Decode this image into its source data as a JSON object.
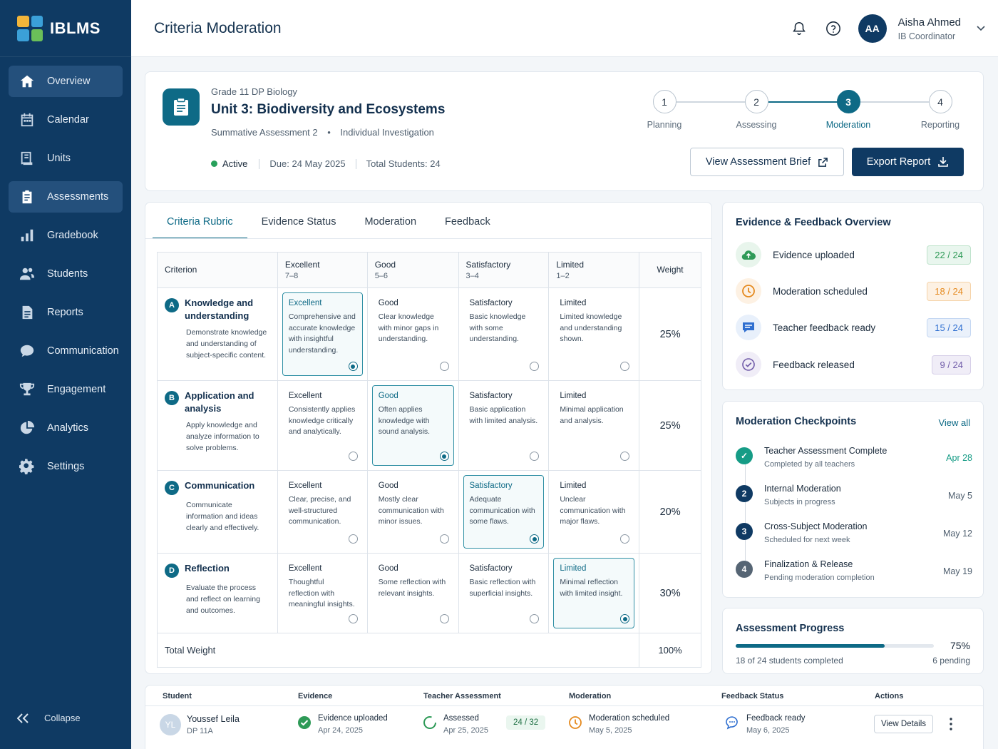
{
  "brand": {
    "name": "IBLMS"
  },
  "sidebar": {
    "items": [
      {
        "label": "Overview",
        "icon": "home-icon",
        "active": true
      },
      {
        "label": "Calendar",
        "icon": "calendar-icon",
        "active": false
      },
      {
        "label": "Units",
        "icon": "book-icon",
        "active": false
      },
      {
        "label": "Assessments",
        "icon": "clipboard-icon",
        "active": true
      },
      {
        "label": "Gradebook",
        "icon": "bar-chart-icon",
        "active": false
      },
      {
        "label": "Students",
        "icon": "users-icon",
        "active": false
      },
      {
        "label": "Reports",
        "icon": "document-icon",
        "active": false
      },
      {
        "label": "Communication",
        "icon": "chat-icon",
        "active": false
      },
      {
        "label": "Engagement",
        "icon": "trophy-icon",
        "active": false
      },
      {
        "label": "Analytics",
        "icon": "pie-chart-icon",
        "active": false
      },
      {
        "label": "Settings",
        "icon": "gear-icon",
        "active": false
      }
    ],
    "collapse_label": "Collapse"
  },
  "topbar": {
    "title": "Criteria Moderation",
    "user": {
      "initials": "AA",
      "name": "Aisha Ahmed",
      "role": "IB Coordinator"
    }
  },
  "assessment": {
    "grade": "Grade 11 DP Biology",
    "unit_title": "Unit 3: Biodiversity and Ecosystems",
    "type": "Summative Assessment 2",
    "task": "Individual Investigation",
    "status": "Active",
    "due": "Due: 24 May 2025",
    "total_students": "Total Students: 24",
    "steps": [
      {
        "num": "1",
        "label": "Planning"
      },
      {
        "num": "2",
        "label": "Assessing"
      },
      {
        "num": "3",
        "label": "Moderation"
      },
      {
        "num": "4",
        "label": "Reporting"
      }
    ],
    "active_step": 3,
    "view_brief_label": "View Assessment Brief",
    "export_label": "Export Report"
  },
  "tabs": [
    "Criteria Rubric",
    "Evidence Status",
    "Moderation",
    "Feedback"
  ],
  "rubric": {
    "headers": {
      "criterion": "Criterion",
      "levels": [
        {
          "name": "Excellent",
          "range": "7–8"
        },
        {
          "name": "Good",
          "range": "5–6"
        },
        {
          "name": "Satisfactory",
          "range": "3–4"
        },
        {
          "name": "Limited",
          "range": "1–2"
        }
      ],
      "weight": "Weight"
    },
    "rows": [
      {
        "letter": "A",
        "name": "Knowledge and understanding",
        "desc": "Demonstrate knowledge and understanding of subject-specific content.",
        "selected": 0,
        "weight": "25%",
        "levels": [
          {
            "title": "Excellent",
            "desc": "Comprehensive and accurate knowledge with insightful understanding."
          },
          {
            "title": "Good",
            "desc": "Clear knowledge with minor gaps in understanding."
          },
          {
            "title": "Satisfactory",
            "desc": "Basic knowledge with some understanding."
          },
          {
            "title": "Limited",
            "desc": "Limited knowledge and understanding shown."
          }
        ]
      },
      {
        "letter": "B",
        "name": "Application and analysis",
        "desc": "Apply knowledge and analyze information to solve problems.",
        "selected": 1,
        "weight": "25%",
        "levels": [
          {
            "title": "Excellent",
            "desc": "Consistently applies knowledge critically and analytically."
          },
          {
            "title": "Good",
            "desc": "Often applies knowledge with sound analysis."
          },
          {
            "title": "Satisfactory",
            "desc": "Basic application with limited analysis."
          },
          {
            "title": "Limited",
            "desc": "Minimal application and analysis."
          }
        ]
      },
      {
        "letter": "C",
        "name": "Communication",
        "desc": "Communicate information and ideas clearly and effectively.",
        "selected": 2,
        "weight": "20%",
        "levels": [
          {
            "title": "Excellent",
            "desc": "Clear, precise, and well-structured communication."
          },
          {
            "title": "Good",
            "desc": "Mostly clear communication with minor issues."
          },
          {
            "title": "Satisfactory",
            "desc": "Adequate communication with some flaws."
          },
          {
            "title": "Limited",
            "desc": "Unclear communication with major flaws."
          }
        ]
      },
      {
        "letter": "D",
        "name": "Reflection",
        "desc": "Evaluate the process and reflect on learning and outcomes.",
        "selected": 3,
        "weight": "30%",
        "levels": [
          {
            "title": "Excellent",
            "desc": "Thoughtful reflection with meaningful insights."
          },
          {
            "title": "Good",
            "desc": "Some reflection with relevant insights."
          },
          {
            "title": "Satisfactory",
            "desc": "Basic reflection with superficial insights."
          },
          {
            "title": "Limited",
            "desc": "Minimal reflection with limited insight."
          }
        ]
      }
    ],
    "total_label": "Total Weight",
    "total_value": "100%"
  },
  "evidence_overview": {
    "title": "Evidence & Feedback Overview",
    "items": [
      {
        "label": "Evidence uploaded",
        "count": "22 / 24",
        "icon": "cloud-upload-icon",
        "color": "#2e9a57",
        "bg": "#e8f5ec",
        "badge_bg": "#e9f6ee",
        "badge_border": "#bfe3cc"
      },
      {
        "label": "Moderation scheduled",
        "count": "18 / 24",
        "icon": "clock-icon",
        "color": "#e58a1f",
        "bg": "#fdf1e3",
        "badge_bg": "#fdf1e3",
        "badge_border": "#f5d3a8"
      },
      {
        "label": "Teacher feedback ready",
        "count": "15 / 24",
        "icon": "message-icon",
        "color": "#2f6fd0",
        "bg": "#e8f0fb",
        "badge_bg": "#eaf1fb",
        "badge_border": "#c4d7f2"
      },
      {
        "label": "Feedback released",
        "count": "9 / 24",
        "icon": "check-circle-icon",
        "color": "#6f5aa8",
        "bg": "#f0edf7",
        "badge_bg": "#f0edf7",
        "badge_border": "#d6cfe8"
      }
    ]
  },
  "checkpoints": {
    "title": "Moderation Checkpoints",
    "view_all": "View all",
    "items": [
      {
        "num": "✓",
        "title": "Teacher Assessment Complete",
        "sub": "Completed by all teachers",
        "date": "Apr 28",
        "state": "done"
      },
      {
        "num": "2",
        "title": "Internal Moderation",
        "sub": "Subjects in progress",
        "date": "May 5",
        "state": "current"
      },
      {
        "num": "3",
        "title": "Cross-Subject Moderation",
        "sub": "Scheduled for next week",
        "date": "May 12",
        "state": "current"
      },
      {
        "num": "4",
        "title": "Finalization & Release",
        "sub": "Pending moderation completion",
        "date": "May 19",
        "state": "muted"
      }
    ]
  },
  "progress": {
    "title": "Assessment Progress",
    "percent_label": "75%",
    "fraction": 0.75,
    "completed": "18 of 24 students completed",
    "pending": "6 pending"
  },
  "students_table": {
    "headers": [
      "Student",
      "Evidence",
      "Teacher Assessment",
      "Moderation",
      "Feedback Status",
      "Actions"
    ],
    "row": {
      "initials": "YL",
      "name": "Youssef Leila",
      "class": "DP 11A",
      "evidence": "Evidence uploaded",
      "evidence_date": "Apr 24, 2025",
      "assessment": "Assessed",
      "assessment_date": "Apr 25, 2025",
      "score": "24 / 32",
      "moderation": "Moderation scheduled",
      "moderation_date": "May 5, 2025",
      "feedback": "Feedback ready",
      "feedback_date": "May 6, 2025",
      "action": "View Details"
    }
  }
}
